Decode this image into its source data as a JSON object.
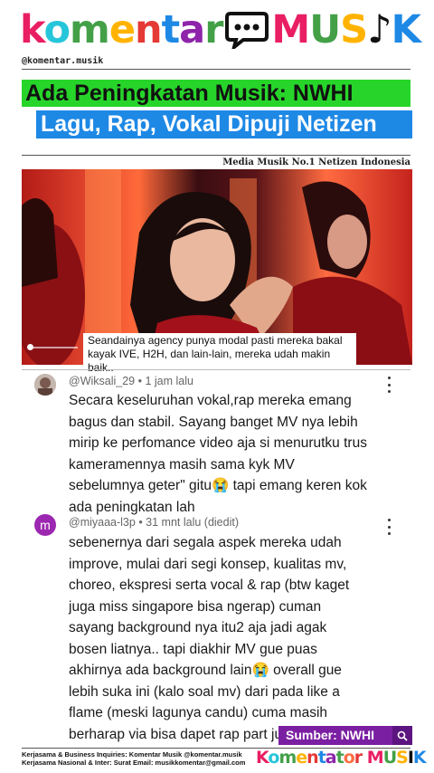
{
  "brand": {
    "logo_word1": "komentar",
    "logo_word2": "MUSIK",
    "handle": "@komentar.musik",
    "tagline": "Media Musik No.1 Netizen Indonesia"
  },
  "headline": {
    "line1": "Ada Peningkatan Musik: NWHI",
    "line2": "Lagu, Rap, Vokal Dipuji Netizen"
  },
  "video": {
    "subtitle": "Seandainya agency punya modal pasti mereka bakal kayak IVE, H2H, dan lain-lain, mereka udah makin baik..",
    "progress": 0.05
  },
  "comments": [
    {
      "author": "@Wiksali_29",
      "time": "1 jam lalu",
      "text": "Secara keseluruhan vokal,rap mereka emang bagus dan stabil. Sayang banget MV nya lebih mirip ke perfomance video aja si menurutku trus kameramennya masih sama kyk MV sebelumnya geter\" gitu😭 tapi emang keren kok ada peningkatan lah"
    },
    {
      "author": "@miyaaa-l3p",
      "time": "31 mnt lalu (diedit)",
      "avatar_letter": "m",
      "text": "sebenernya dari segala aspek mereka udah improve, mulai dari segi konsep, kualitas mv, choreo, ekspresi serta vocal & rap (btw  kaget juga miss singapore bisa ngerap) cuman sayang background nya itu2 aja jadi agak bosen liatnya.. tapi diakhir MV gue puas akhirnya ada background lain😭 overall gue lebih suka ini (kalo soal mv) dari pada like a flame (meski lagunya candu) cuma masih berharap via bisa dapet rap part juga😭😭😭"
    }
  ],
  "source": {
    "label": "Sumber: NWHI",
    "icon": "search-icon"
  },
  "footer": {
    "line1": "Kerjasama & Business Inquiries: Komentar Musik @komentar.musik",
    "line2": "Kerjasama Nasional & Inter: Surat Email: musikkomentar@gmail.com",
    "logo_word1": "Komentator",
    "logo_word2": "MUSIK"
  },
  "colors": {
    "headline1_bg": "#27d52a",
    "headline2_bg": "#1e88e5",
    "source_bg": "#7b1fa2",
    "avatar_m": "#9c27b0"
  }
}
